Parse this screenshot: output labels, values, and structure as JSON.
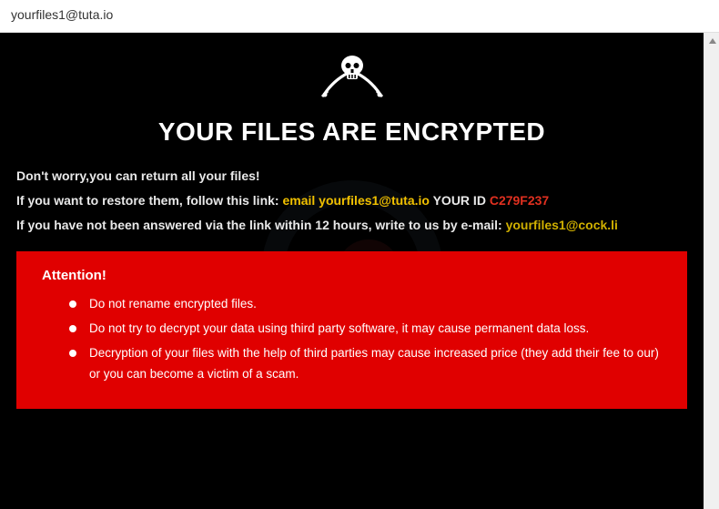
{
  "titlebar": "yourfiles1@tuta.io",
  "heading": "YOUR FILES ARE ENCRYPTED",
  "line1": "Don't worry,you can return all your files!",
  "line2_prefix": "If you want to restore them, follow this link: ",
  "line2_email_label": "email yourfiles1@tuta.io",
  "line2_yourid_label": "  YOUR ID ",
  "line2_id": "C279F237",
  "line3_prefix": "If you have not been answered via the link within 12 hours, write to us by e-mail: ",
  "line3_email": "yourfiles1@cock.li",
  "attention": {
    "title": "Attention!",
    "bullets": [
      "Do not rename encrypted files.",
      "Do not try to decrypt your data using third party software, it may cause permanent data loss.",
      "Decryption of your files with the help of third parties may cause increased price (they add their fee to our) or you can become a victim of a scam."
    ]
  }
}
